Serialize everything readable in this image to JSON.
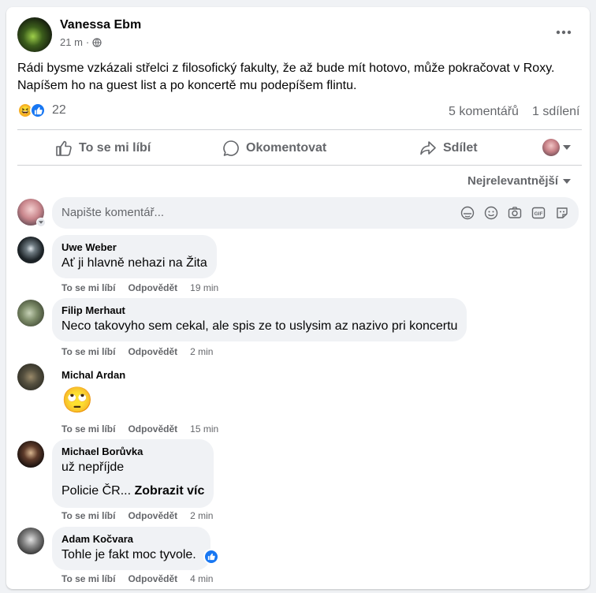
{
  "post": {
    "author": "Vanessa Ebm",
    "time": "21 m",
    "privacy_icon": "globe-icon",
    "text_line1": "Rádi bysme vzkázali střelci z filosofický fakulty, že až bude mít hotovo, může pokračovat v Roxy.",
    "text_line2": "Napíšem ho na guest list a po koncertě mu podepíšem flintu.",
    "reaction_count": "22",
    "comments_count": "5 komentářů",
    "shares_count": "1 sdílení"
  },
  "actions": {
    "like": "To se mi líbí",
    "comment": "Okomentovat",
    "share": "Sdílet"
  },
  "sort_label": "Nejrelevantnější",
  "composer": {
    "placeholder": "Napište komentář..."
  },
  "comments": [
    {
      "name": "Uwe Weber",
      "text": "Ať ji hlavně nehazi na Žita",
      "like": "To se mi líbí",
      "reply": "Odpovědět",
      "time": "19 min"
    },
    {
      "name": "Filip Merhaut",
      "text": "Neco takovyho sem cekal, ale spis ze to uslysim az nazivo pri koncertu",
      "like": "To se mi líbí",
      "reply": "Odpovědět",
      "time": "2 min"
    },
    {
      "name": "Michal Ardan",
      "text": "🙄",
      "like": "To se mi líbí",
      "reply": "Odpovědět",
      "time": "15 min"
    },
    {
      "name": "Michael Borůvka",
      "text": "už nepříjde",
      "text2": "Policie ČR...",
      "see_more": "Zobrazit víc",
      "like": "To se mi líbí",
      "reply": "Odpovědět",
      "time": "2 min"
    },
    {
      "name": "Adam Kočvara",
      "text": "Tohle je fakt moc tyvole.",
      "like": "To se mi líbí",
      "reply": "Odpovědět",
      "time": "4 min"
    }
  ],
  "colors": {
    "accent": "#1877f2",
    "haha": "#f7b125",
    "secondary_text": "#65676b",
    "bubble": "#f0f2f5"
  }
}
